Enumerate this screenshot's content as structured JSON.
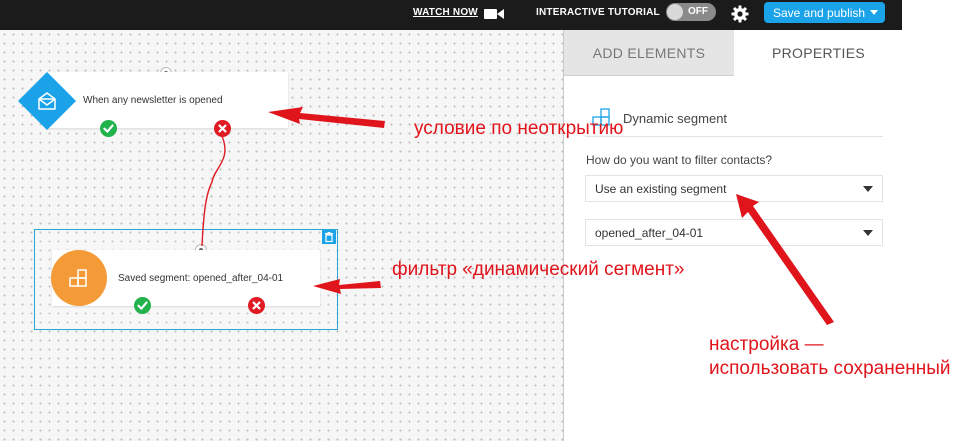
{
  "topbar": {
    "watch_now": "WATCH NOW",
    "interactive_tutorial": "INTERACTIVE TUTORIAL",
    "toggle_state": "OFF",
    "publish_label": "Save and publish",
    "icons": [
      "video-camera-icon",
      "gear-icon",
      "chevron-down-icon"
    ]
  },
  "canvas": {
    "trigger_node": {
      "label": "When any newsletter is opened",
      "icon": "envelope-icon"
    },
    "segment_node": {
      "label": "Saved segment: opened_after_04-01",
      "icon": "dynamic-segment-icon"
    }
  },
  "panel": {
    "tabs": [
      {
        "label": "ADD ELEMENTS",
        "active": false
      },
      {
        "label": "PROPERTIES",
        "active": true
      }
    ],
    "element_title": "Dynamic segment",
    "question": "How do you want to filter contacts?",
    "filter_mode": {
      "selected": "Use an existing segment"
    },
    "segment": {
      "selected": "opened_after_04-01"
    }
  },
  "annotations": {
    "condition": "условие по неоткрытию",
    "filter": "фильтр «динамический сегмент»",
    "setting_line1": "настройка —",
    "setting_line2": "использовать сохраненный"
  },
  "colors": {
    "accent": "#1aa3e8",
    "annotation": "#e0141b",
    "success": "#22b24c",
    "failure": "#e01b24",
    "segment_node": "#f49a36",
    "topbar": "#1b1b1b"
  }
}
